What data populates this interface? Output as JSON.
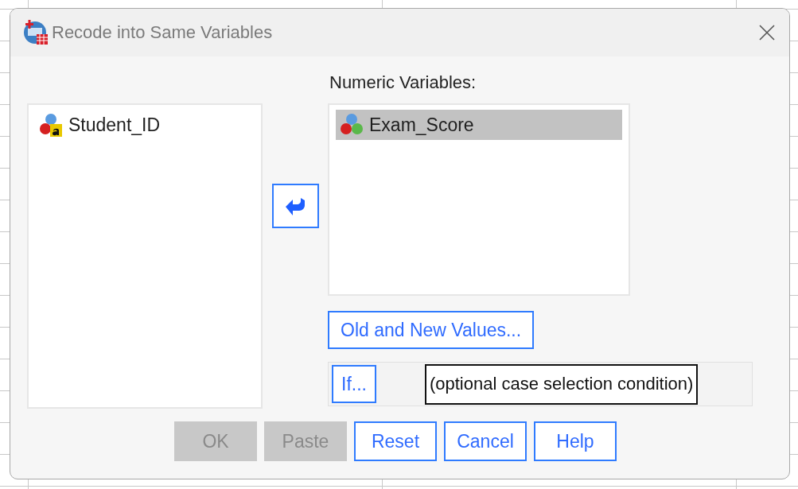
{
  "window": {
    "title": "Recode into Same Variables"
  },
  "source_list": {
    "items": [
      {
        "name": "Student_ID",
        "kind": "string",
        "selected": false
      }
    ]
  },
  "target_list": {
    "label": "Numeric Variables:",
    "items": [
      {
        "name": "Exam_Score",
        "kind": "scale",
        "selected": true
      }
    ]
  },
  "old_new_button": {
    "label": "Old and New Values..."
  },
  "if_button": {
    "label": "If..."
  },
  "condition": "(optional case selection condition)",
  "buttons": [
    {
      "label": "OK",
      "disabled": true
    },
    {
      "label": "Paste",
      "disabled": true
    },
    {
      "label": "Reset",
      "disabled": false
    },
    {
      "label": "Cancel",
      "disabled": false
    },
    {
      "label": "Help",
      "disabled": false
    }
  ]
}
